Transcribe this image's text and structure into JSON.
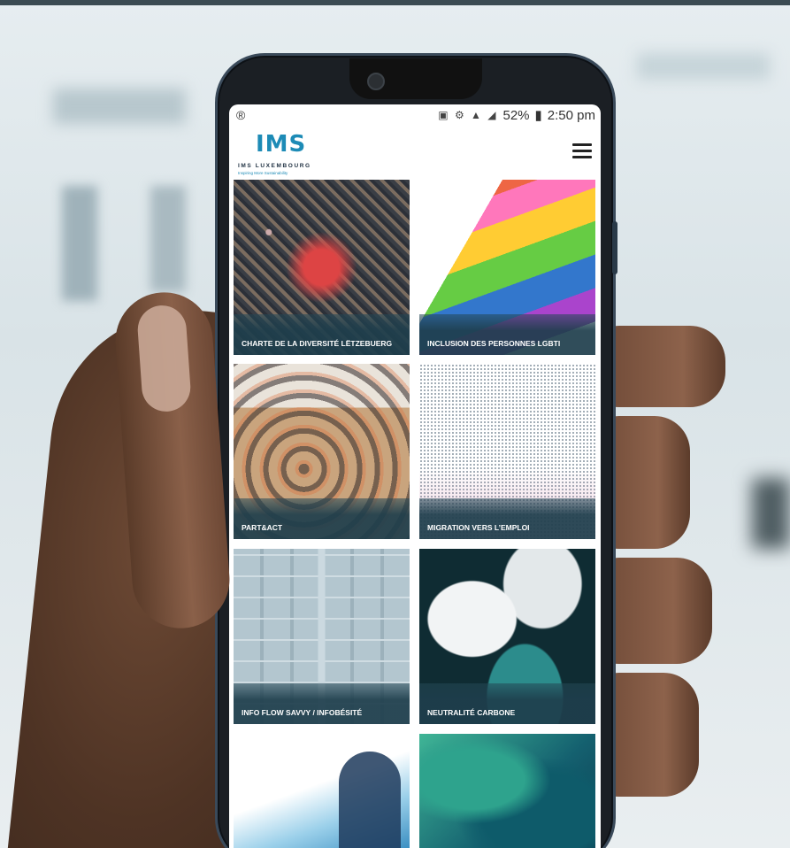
{
  "statusbar": {
    "left_icon": "®",
    "icons": "▣ ⚙ ▲ ◢",
    "battery": "52%",
    "battery_icon": "▮",
    "time": "2:50 pm"
  },
  "header": {
    "logo_mark": "IMS",
    "logo_line": "IMS LUXEMBOURG",
    "logo_tag": "Inspiring More Sustainability",
    "menu_icon": "hamburger-menu-icon"
  },
  "tiles": [
    {
      "label": "CHARTE DE LA DIVERSITÉ LËTZEBUERG"
    },
    {
      "label": "INCLUSION DES PERSONNES LGBTI"
    },
    {
      "label": "PART&ACT"
    },
    {
      "label": "MIGRATION VERS L’EMPLOI"
    },
    {
      "label": "INFO FLOW SAVVY / INFOBÉSITÉ"
    },
    {
      "label": "NEUTRALITÉ CARBONE"
    },
    {
      "label": ""
    },
    {
      "label": ""
    }
  ],
  "colors": {
    "brand": "#1d8bb6",
    "tile_overlay": "#1e3e4c"
  }
}
